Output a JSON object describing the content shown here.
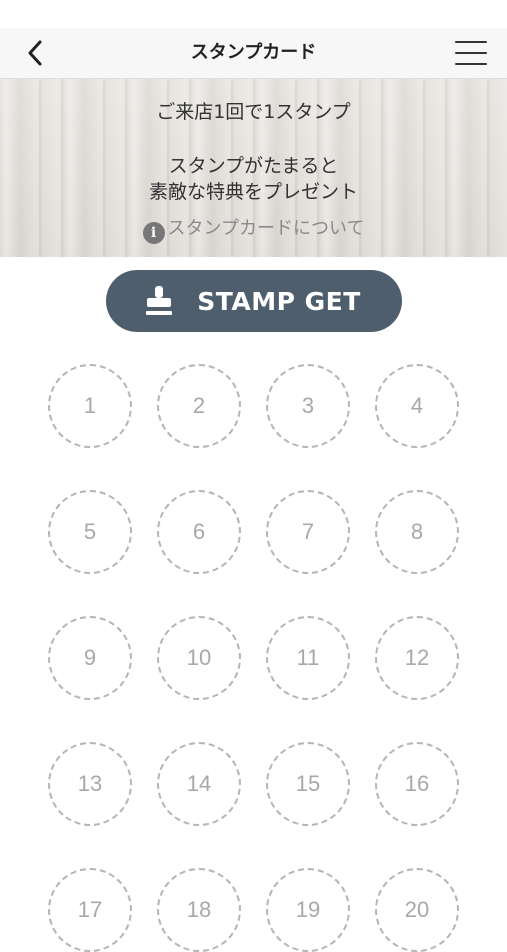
{
  "nav": {
    "title": "スタンプカード"
  },
  "banner": {
    "line1": "ご来店1回で1スタンプ",
    "line2": "スタンプがたまると",
    "line3": "素敵な特典をプレゼント",
    "info_icon_glyph": "i",
    "info_link": "スタンプカードについて"
  },
  "stamp_button": {
    "label": "STAMP GET"
  },
  "colors": {
    "button": "#4e5e6c",
    "slot_border": "#b5b5b5",
    "slot_text": "#a8a8a8"
  },
  "slots": [
    "1",
    "2",
    "3",
    "4",
    "5",
    "6",
    "7",
    "8",
    "9",
    "10",
    "11",
    "12",
    "13",
    "14",
    "15",
    "16",
    "17",
    "18",
    "19",
    "20"
  ]
}
